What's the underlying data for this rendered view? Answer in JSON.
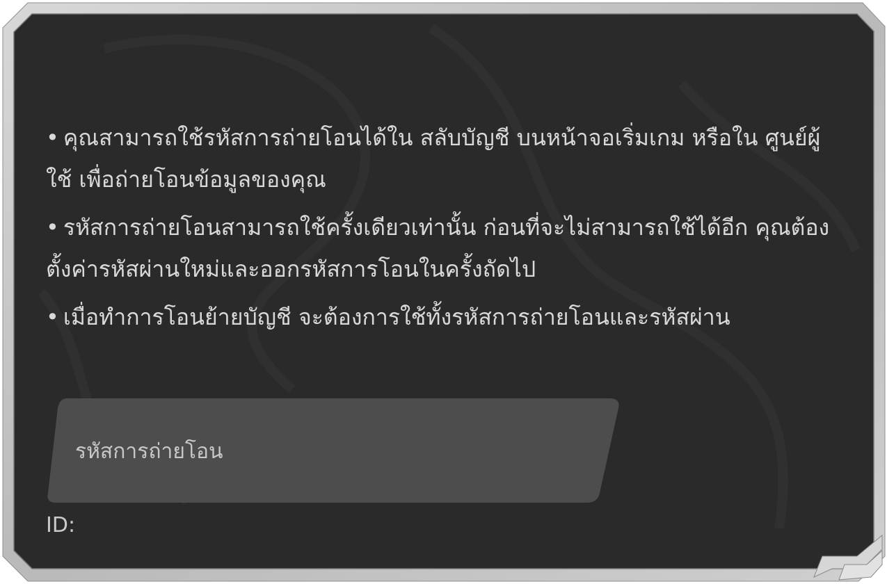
{
  "dialog": {
    "bullet_symbol": "•",
    "bullets": [
      {
        "text": "คุณสามารถใช้รหัสการถ่ายโอนได้ใน สลับบัญชี บนหน้าจอเริ่มเกม หรือใน ศูนย์ผู้ใช้ เพื่อถ่ายโอนข้อมูลของคุณ"
      },
      {
        "text": "รหัสการถ่ายโอนสามารถใช้ครั้งเดียวเท่านั้น ก่อนที่จะไม่สามารถใช้ได้อีก คุณต้องตั้งค่ารหัสผ่านใหม่และออกรหัสการโอนในครั้งถัดไป"
      },
      {
        "text": "เมื่อทำการโอนย้ายบัญชี จะต้องการใช้ทั้งรหัสการถ่ายโอนและรหัสผ่าน"
      }
    ],
    "transfer_code_input": {
      "placeholder": "รหัสการถ่ายโอน",
      "value": ""
    },
    "id_label": "ID:",
    "id_value": ""
  },
  "colors": {
    "panel_bg": "#2b2b2b",
    "panel_border": "#c9c9c9",
    "input_bg": "#4d4d4d",
    "text": "#d9d9d9"
  }
}
